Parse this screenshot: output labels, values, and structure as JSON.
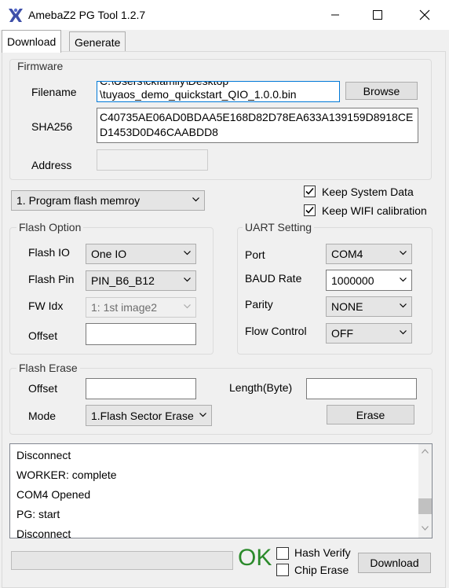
{
  "window": {
    "title": "AmebaZ2 PG Tool 1.2.7",
    "icons": {
      "app": "ameba-logo-icon",
      "minimize": "minimize-icon",
      "maximize": "maximize-icon",
      "close": "close-icon"
    }
  },
  "tabs": [
    {
      "label": "Download",
      "active": true
    },
    {
      "label": "Generate",
      "active": false
    }
  ],
  "firmware": {
    "title": "Firmware",
    "filename_label": "Filename",
    "filename_line1": "C:\\Users\\ckfamily\\Desktop",
    "filename_line2": "\\tuyaos_demo_quickstart_QIO_1.0.0.bin",
    "browse_label": "Browse",
    "sha_label": "SHA256",
    "sha_line1": "C40735AE06AD0BDAA5E168D82D78EA633A139159D8918CE",
    "sha_line2": "D1453D0D46CAABDD8",
    "address_label": "Address",
    "address_value": ""
  },
  "mode_select": {
    "value": "1. Program flash memroy"
  },
  "options": {
    "keep_system_data": {
      "label": "Keep System Data",
      "checked": true
    },
    "keep_wifi_calibration": {
      "label": "Keep WIFI calibration",
      "checked": true
    }
  },
  "flash_option": {
    "title": "Flash Option",
    "flash_io_label": "Flash IO",
    "flash_io_value": "One IO",
    "flash_pin_label": "Flash Pin",
    "flash_pin_value": "PIN_B6_B12",
    "fw_idx_label": "FW Idx",
    "fw_idx_value": "1: 1st image2",
    "offset_label": "Offset",
    "offset_value": ""
  },
  "uart": {
    "title": "UART Setting",
    "port_label": "Port",
    "port_value": "COM4",
    "baud_label": "BAUD Rate",
    "baud_value": "1000000",
    "parity_label": "Parity",
    "parity_value": "NONE",
    "flow_label": "Flow Control",
    "flow_value": "OFF"
  },
  "flash_erase": {
    "title": "Flash Erase",
    "offset_label": "Offset",
    "offset_value": "",
    "length_label": "Length(Byte)",
    "length_value": "",
    "mode_label": "Mode",
    "mode_value": "1.Flash Sector Erase",
    "erase_label": "Erase"
  },
  "log": {
    "lines": [
      "Disconnect",
      "WORKER: complete",
      "COM4 Opened",
      "PG: start",
      "Disconnect"
    ],
    "scroll_position": 0.85
  },
  "footer": {
    "progress": 0,
    "status": "OK",
    "status_color": "#2b8a2b",
    "hash_verify": {
      "label": "Hash Verify",
      "checked": false
    },
    "chip_erase": {
      "label": "Chip Erase",
      "checked": false
    },
    "download_label": "Download"
  },
  "colors": {
    "focus": "#0078d7",
    "window_bg": "#f0f0f0"
  }
}
